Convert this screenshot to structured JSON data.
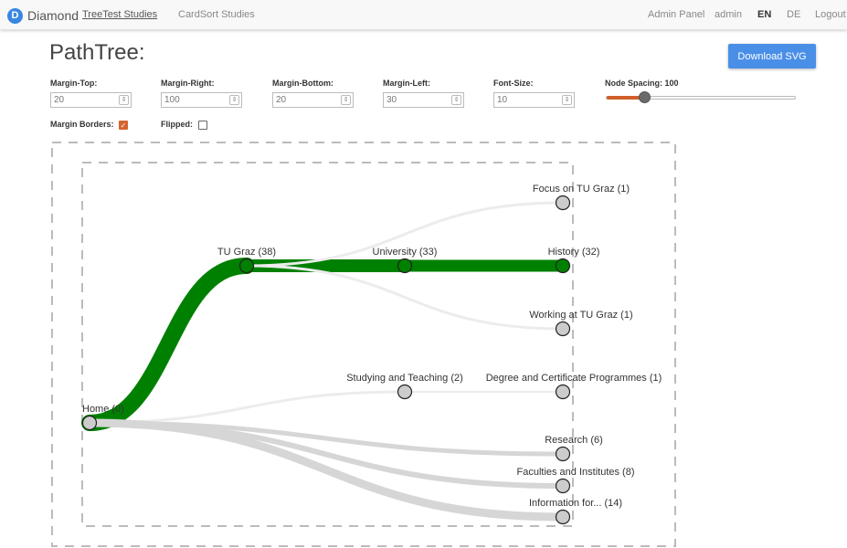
{
  "navbar": {
    "brand_letter": "D",
    "brand_name": "Diamond",
    "links": [
      "TreeTest Studies",
      "CardSort Studies"
    ],
    "admin_panel": "Admin Panel",
    "user": "admin",
    "lang_en": "EN",
    "lang_de": "DE",
    "logout": "Logout"
  },
  "page": {
    "title": "PathTree:",
    "download_label": "Download SVG"
  },
  "controls": {
    "margin_top": {
      "label": "Margin-Top:",
      "value": "20"
    },
    "margin_right": {
      "label": "Margin-Right:",
      "value": "100"
    },
    "margin_bottom": {
      "label": "Margin-Bottom:",
      "value": "20"
    },
    "margin_left": {
      "label": "Margin-Left:",
      "value": "30"
    },
    "font_size": {
      "label": "Font-Size:",
      "value": "10"
    },
    "node_spacing": {
      "label": "Node Spacing: 100",
      "fraction": 0.2
    },
    "margin_borders": {
      "label": "Margin Borders:",
      "checked": true
    },
    "flipped": {
      "label": "Flipped:",
      "checked": false
    }
  },
  "tree": {
    "nodes": [
      {
        "id": "home",
        "label": "Home (0)",
        "color": "#cccccc"
      },
      {
        "id": "tugraz",
        "label": "TU Graz (38)",
        "color": "#008000"
      },
      {
        "id": "university",
        "label": "University (33)",
        "color": "#008000"
      },
      {
        "id": "history",
        "label": "History (32)",
        "color": "#008000"
      },
      {
        "id": "focus",
        "label": "Focus on TU Graz (1)",
        "color": "#cccccc"
      },
      {
        "id": "working",
        "label": "Working at TU Graz (1)",
        "color": "#cccccc"
      },
      {
        "id": "studying",
        "label": "Studying and Teaching (2)",
        "color": "#cccccc"
      },
      {
        "id": "degree",
        "label": "Degree and Certificate Programmes (1)",
        "color": "#cccccc"
      },
      {
        "id": "research",
        "label": "Research (6)",
        "color": "#cccccc"
      },
      {
        "id": "faculties",
        "label": "Faculties and Institutes (8)",
        "color": "#cccccc"
      },
      {
        "id": "information",
        "label": "Information for... (14)",
        "color": "#cccccc"
      }
    ],
    "path_color": "#008000",
    "link_color": "#cccccc"
  }
}
